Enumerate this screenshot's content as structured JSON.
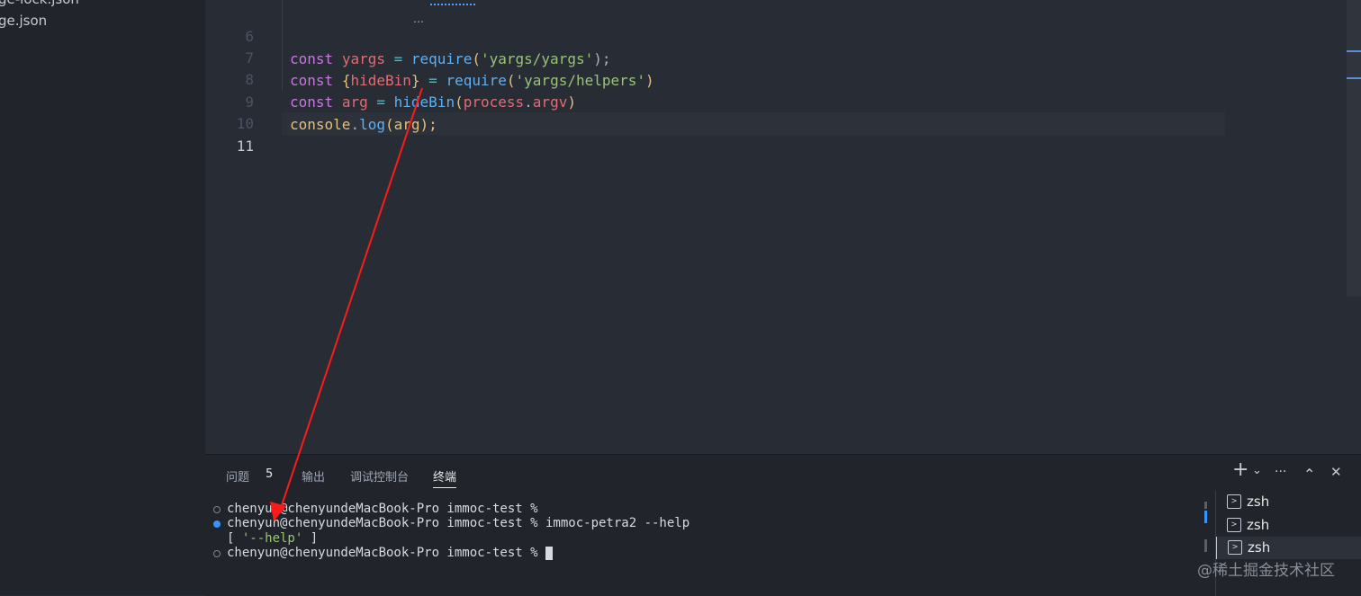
{
  "explorer": {
    "files": [
      "ge-lock.json",
      "ge.json"
    ]
  },
  "editor": {
    "line_numbers": [
      "6",
      "7",
      "8",
      "9",
      "10",
      "11"
    ],
    "lines": {
      "l6": {
        "kw": "const",
        "var": "yargs",
        "op": "=",
        "fn": "require",
        "open": "(",
        "str": "'yargs/yargs'",
        "close": ");"
      },
      "l7": {
        "kw": "const",
        "brace_open": "{",
        "var": "hideBin",
        "brace_close": "}",
        "op": "=",
        "fn": "require",
        "open": "(",
        "str": "'yargs/helpers'",
        "close": ")"
      },
      "l8": {
        "kw": "const",
        "var": "arg",
        "op": "=",
        "fn": "hideBin",
        "open": "(",
        "obj": "process",
        "dot": ".",
        "prop": "argv",
        "close": ")"
      },
      "l9": {
        "obj": "console",
        "dot": ".",
        "fn": "log",
        "open": "(",
        "arg": "arg",
        "close": ");"
      }
    },
    "hover_dots": "…"
  },
  "panel": {
    "tabs": {
      "problems": "问题",
      "problems_count": "5",
      "output": "输出",
      "debug_console": "调试控制台",
      "terminal": "终端"
    },
    "actions": {
      "add": "+",
      "add_dropdown": "⌄",
      "more": "···",
      "maximize": "⌃",
      "close": "✕"
    },
    "terminal": {
      "line1": "chenyun@chenyundeMacBook-Pro immoc-test % ",
      "line2": "chenyun@chenyundeMacBook-Pro immoc-test % immoc-petra2 --help",
      "line3_open": "[ ",
      "line3_str": "'--help'",
      "line3_close": " ]",
      "line4": "chenyun@chenyundeMacBook-Pro immoc-test % "
    },
    "terminal_list": [
      "zsh",
      "zsh",
      "zsh"
    ],
    "terminal_icon_glyph": ">"
  },
  "watermark": "@稀土掘金技术社区",
  "colors": {
    "keyword": "#c678dd",
    "variable": "#e06c75",
    "function": "#61afef",
    "string": "#98c379",
    "annotation_arrow": "#ff1a1a"
  },
  "icons": [
    "plus-icon",
    "chevron-down-icon",
    "more-icon",
    "chevron-up-icon",
    "close-icon",
    "terminal-icon"
  ]
}
